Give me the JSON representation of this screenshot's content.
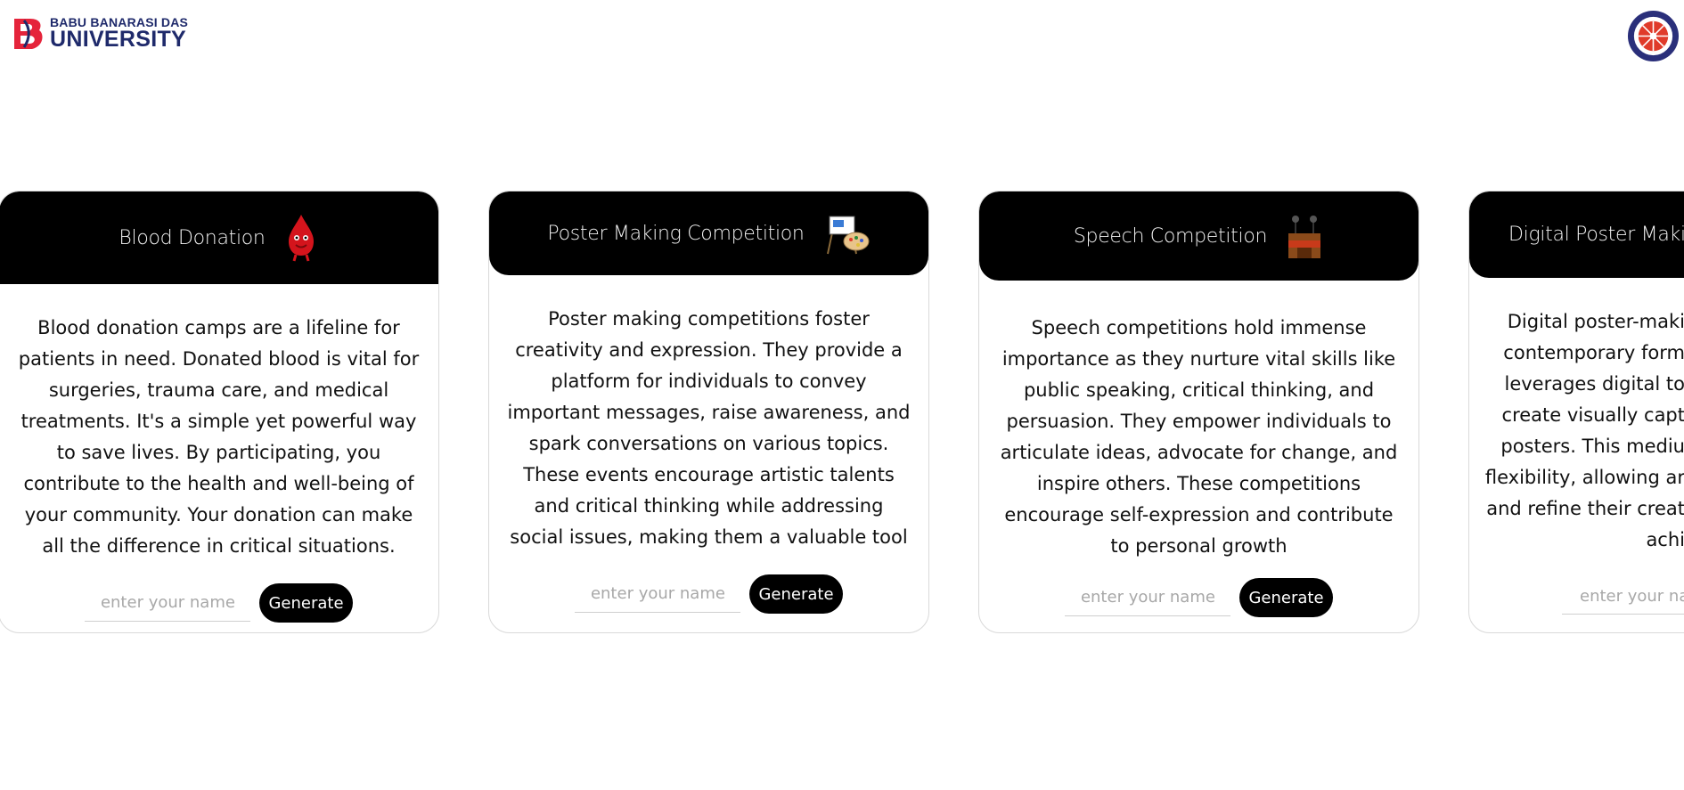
{
  "header": {
    "brand_line1": "BABU BANARASI DAS",
    "brand_line2": "UNIVERSITY",
    "brand_logo_icon": "bbd-logo-icon",
    "nss_logo_icon": "nss-emblem-icon",
    "colors": {
      "brand_red": "#e5243b",
      "brand_navy": "#1f2a6b",
      "nss_blue": "#2a2f7a",
      "nss_red": "#e03a2a"
    }
  },
  "cards": [
    {
      "title": "Blood Donation",
      "icon": "blood-drop-mascot-icon",
      "description": "Blood donation camps are a lifeline for patients in need. Donated blood is vital for surgeries, trauma care, and medical treatments. It's a simple yet powerful way to save lives. By participating, you contribute to the health and well-being of your community. Your donation can make all the difference in critical situations.",
      "input_placeholder": "enter your name",
      "button_label": "Generate"
    },
    {
      "title": "Poster Making Competition",
      "icon": "easel-palette-icon",
      "description": "Poster making competitions foster creativity and expression. They provide a platform for individuals to convey important messages, raise awareness, and spark conversations on various topics. These events encourage artistic talents and critical thinking while addressing social issues, making them a valuable tool",
      "input_placeholder": "enter your name",
      "button_label": "Generate"
    },
    {
      "title": "Speech Competition",
      "icon": "podium-microphones-icon",
      "description": "Speech competitions hold immense importance as they nurture vital skills like public speaking, critical thinking, and persuasion. They empower individuals to articulate ideas, advocate for change, and inspire others. These competitions encourage self-expression and contribute to personal growth",
      "input_placeholder": "enter your name",
      "button_label": "Generate"
    },
    {
      "title": "Digital Poster Makin",
      "icon": "",
      "description_lines": [
        "Digital poster-maki",
        "contemporary form",
        "leverages digital to",
        "create visually capt",
        "posters. This mediu",
        "flexibility, allowing ar",
        "and refine their creat",
        "achi"
      ],
      "input_placeholder": "enter your na",
      "button_label": ""
    }
  ]
}
